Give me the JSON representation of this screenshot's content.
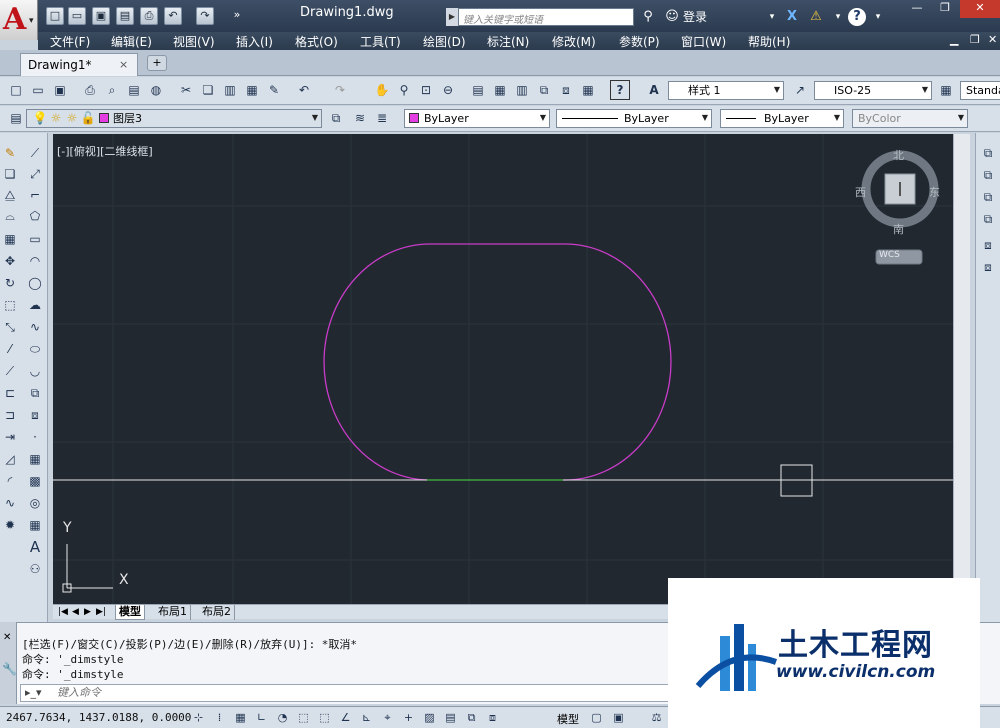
{
  "title": {
    "document": "Drawing1.dwg",
    "search_placeholder": "键入关键字或短语",
    "login": "登录"
  },
  "menu": [
    "文件(F)",
    "编辑(E)",
    "视图(V)",
    "插入(I)",
    "格式(O)",
    "工具(T)",
    "绘图(D)",
    "标注(N)",
    "修改(M)",
    "参数(P)",
    "窗口(W)",
    "帮助(H)"
  ],
  "tab": {
    "name": "Drawing1*",
    "close": "×"
  },
  "toolbar1": {
    "text_style": "样式 1",
    "dim_style": "ISO-25",
    "table_style": "Standa"
  },
  "toolbar2": {
    "layer": "图层3",
    "color": "ByLayer",
    "linetype": "ByLayer",
    "lineweight": "ByLayer",
    "plotstyle": "ByColor"
  },
  "viewport": {
    "label": "[-][俯视][二维线框]",
    "compass": {
      "north": "北",
      "south": "南",
      "east": "东",
      "west": "西"
    },
    "wcs": "WCS",
    "ucs_x": "X",
    "ucs_y": "Y"
  },
  "layout_tabs": [
    "模型",
    "布局1",
    "布局2"
  ],
  "command": {
    "history": [
      "[栏选(F)/窗交(C)/投影(P)/边(E)/删除(R)/放弃(U)]: *取消*",
      "命令: '_dimstyle",
      "命令: '_dimstyle"
    ],
    "placeholder": "键入命令"
  },
  "status": {
    "coords": "2467.7634, 1437.0188, 0.0000",
    "model": "模型"
  },
  "watermark": {
    "name": "土木工程网",
    "url": "www.civilcn.com"
  },
  "colors": {
    "accent": "#c0141b",
    "canvas": "#212830",
    "shape": "#c83cc8",
    "highlight": "#2fa12f"
  }
}
